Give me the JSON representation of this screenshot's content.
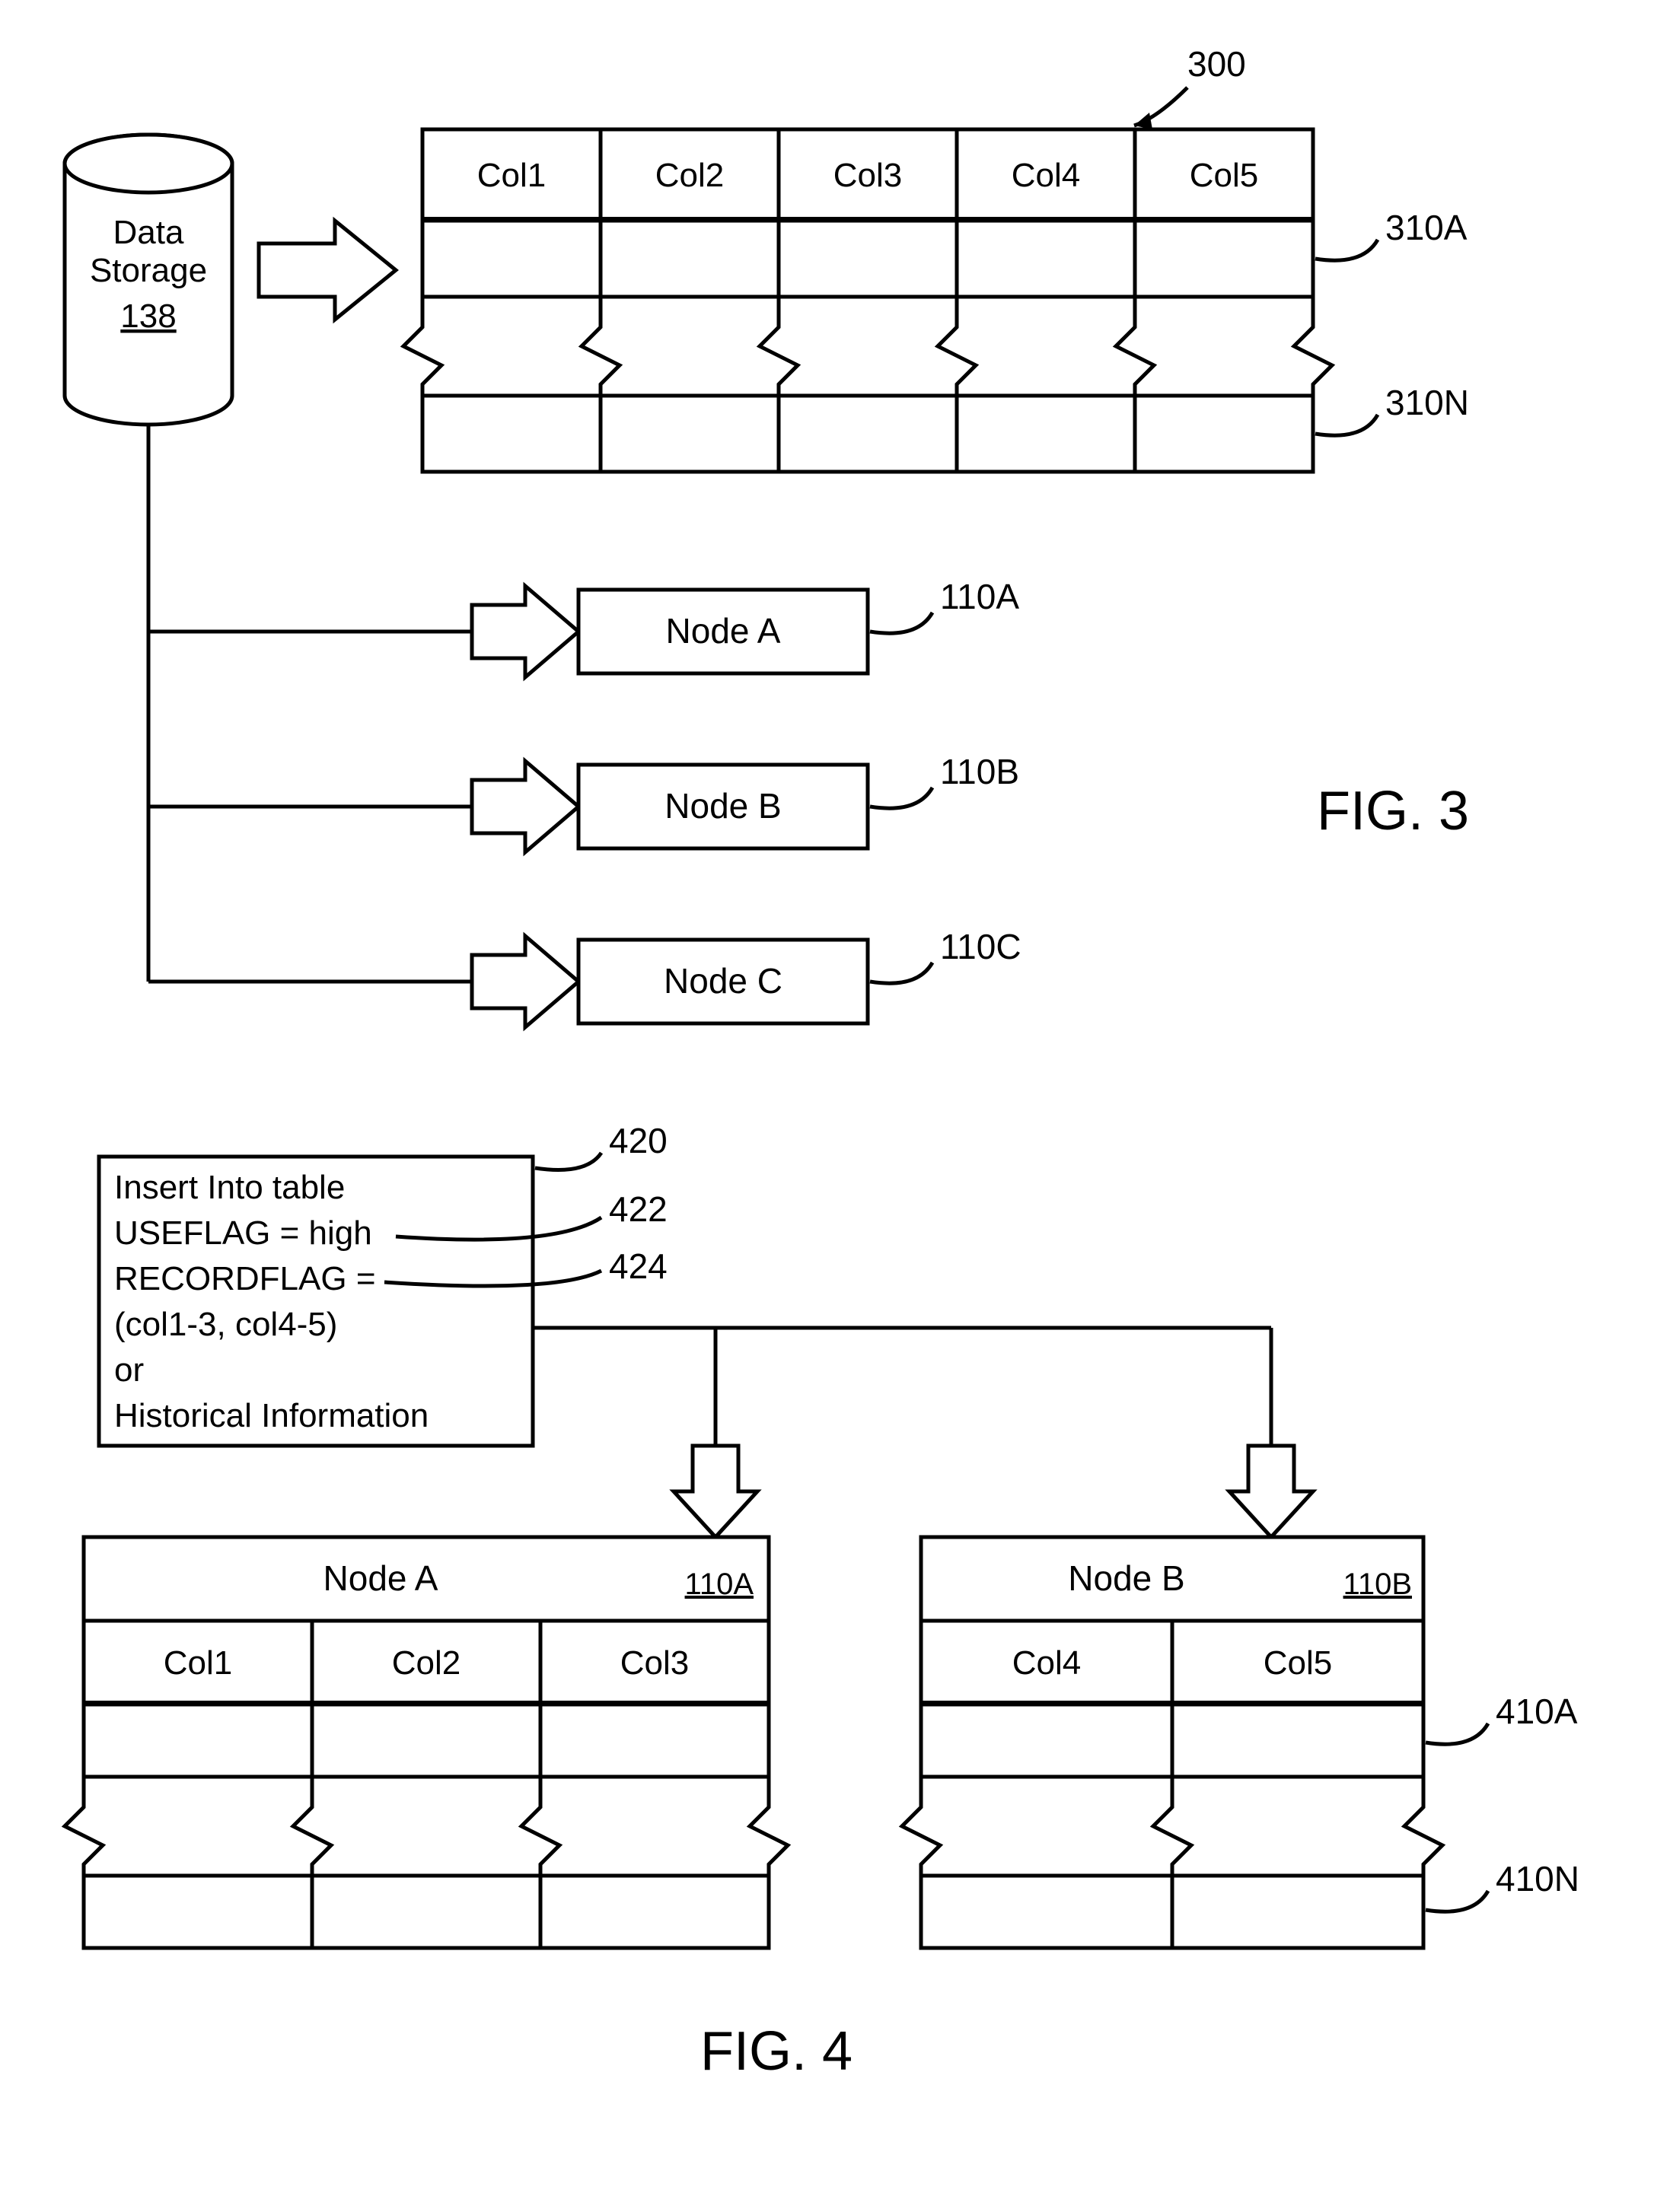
{
  "fig3": {
    "title": "FIG. 3",
    "storage": {
      "label": "Data Storage",
      "ref": "138"
    },
    "table": {
      "ref": "300",
      "headers": [
        "Col1",
        "Col2",
        "Col3",
        "Col4",
        "Col5"
      ],
      "row_first_ref": "310A",
      "row_last_ref": "310N"
    },
    "nodes": [
      {
        "label": "Node A",
        "ref": "110A"
      },
      {
        "label": "Node B",
        "ref": "110B"
      },
      {
        "label": "Node C",
        "ref": "110C"
      }
    ]
  },
  "fig4": {
    "title": "FIG. 4",
    "code": {
      "ref": "420",
      "lines": [
        "Insert Into table",
        "USEFLAG = high",
        "RECORDFLAG =",
        "(col1-3, col4-5)",
        "or",
        "Historical Information"
      ],
      "refs": {
        "useflag": "422",
        "recordflag": "424"
      }
    },
    "nodeA": {
      "label": "Node A",
      "ref": "110A",
      "headers": [
        "Col1",
        "Col2",
        "Col3"
      ]
    },
    "nodeB": {
      "label": "Node B",
      "ref": "110B",
      "headers": [
        "Col4",
        "Col5"
      ]
    },
    "row_first_ref": "410A",
    "row_last_ref": "410N"
  }
}
